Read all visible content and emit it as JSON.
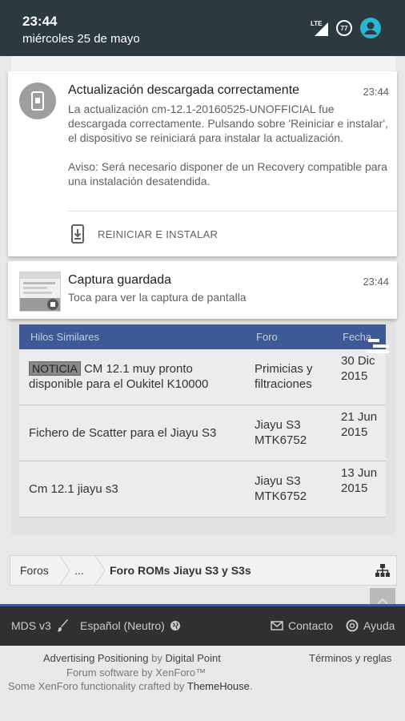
{
  "status_bar": {
    "time": "23:44",
    "date": "miércoles 25 de mayo",
    "network": "LTE",
    "battery": "77"
  },
  "notifications": [
    {
      "title": "Actualización descargada correctamente",
      "time": "23:44",
      "body": "La actualización cm-12.1-20160525-UNOFFICIAL fue descargada correctamente. Pulsando sobre 'Reiniciar e instalar', el dispositivo se reiniciará para instalar la actualización.",
      "warning": "Aviso: Será necesario disponer de un Recovery compatible para una instalación desatendida.",
      "action": "REINICIAR E INSTALAR",
      "icon": "phone-update-icon"
    },
    {
      "title": "Captura guardada",
      "time": "23:44",
      "body": "Toca para ver la captura de pantalla",
      "icon": "screenshot-thumbnail"
    }
  ],
  "threads": {
    "headers": {
      "title": "Hilos Similares",
      "forum": "Foro",
      "date": "Fecha"
    },
    "rows": [
      {
        "badge": "NOTICIA",
        "title": "CM 12.1 muy pronto disponible para el Oukitel K10000",
        "forum": "Primicias y filtraciones",
        "date": "30 Dic 2015"
      },
      {
        "badge": "",
        "title": "Fichero de Scatter para el Jiayu S3",
        "forum": "Jiayu S3 MTK6752",
        "date": "21 Jun 2015"
      },
      {
        "badge": "",
        "title": "Cm 12.1 jiayu s3",
        "forum": "Jiayu S3 MTK6752",
        "date": "13 Jun 2015"
      }
    ]
  },
  "breadcrumb": {
    "items": [
      "Foros",
      "...",
      "Foro ROMs Jiayu S3 y S3s"
    ]
  },
  "footer": {
    "style": "MDS v3",
    "language": "Español (Neutro)",
    "contact": "Contacto",
    "help": "Ayuda",
    "credit1_a": "Advertising Positioning",
    "credit1_by": "by",
    "credit1_b": "Digital Point",
    "credit2": "Forum software by XenForo™",
    "credit3_a": "Some XenForo functionality crafted by",
    "credit3_b": "ThemeHouse",
    "credit3_end": ".",
    "terms": "Términos y reglas"
  }
}
